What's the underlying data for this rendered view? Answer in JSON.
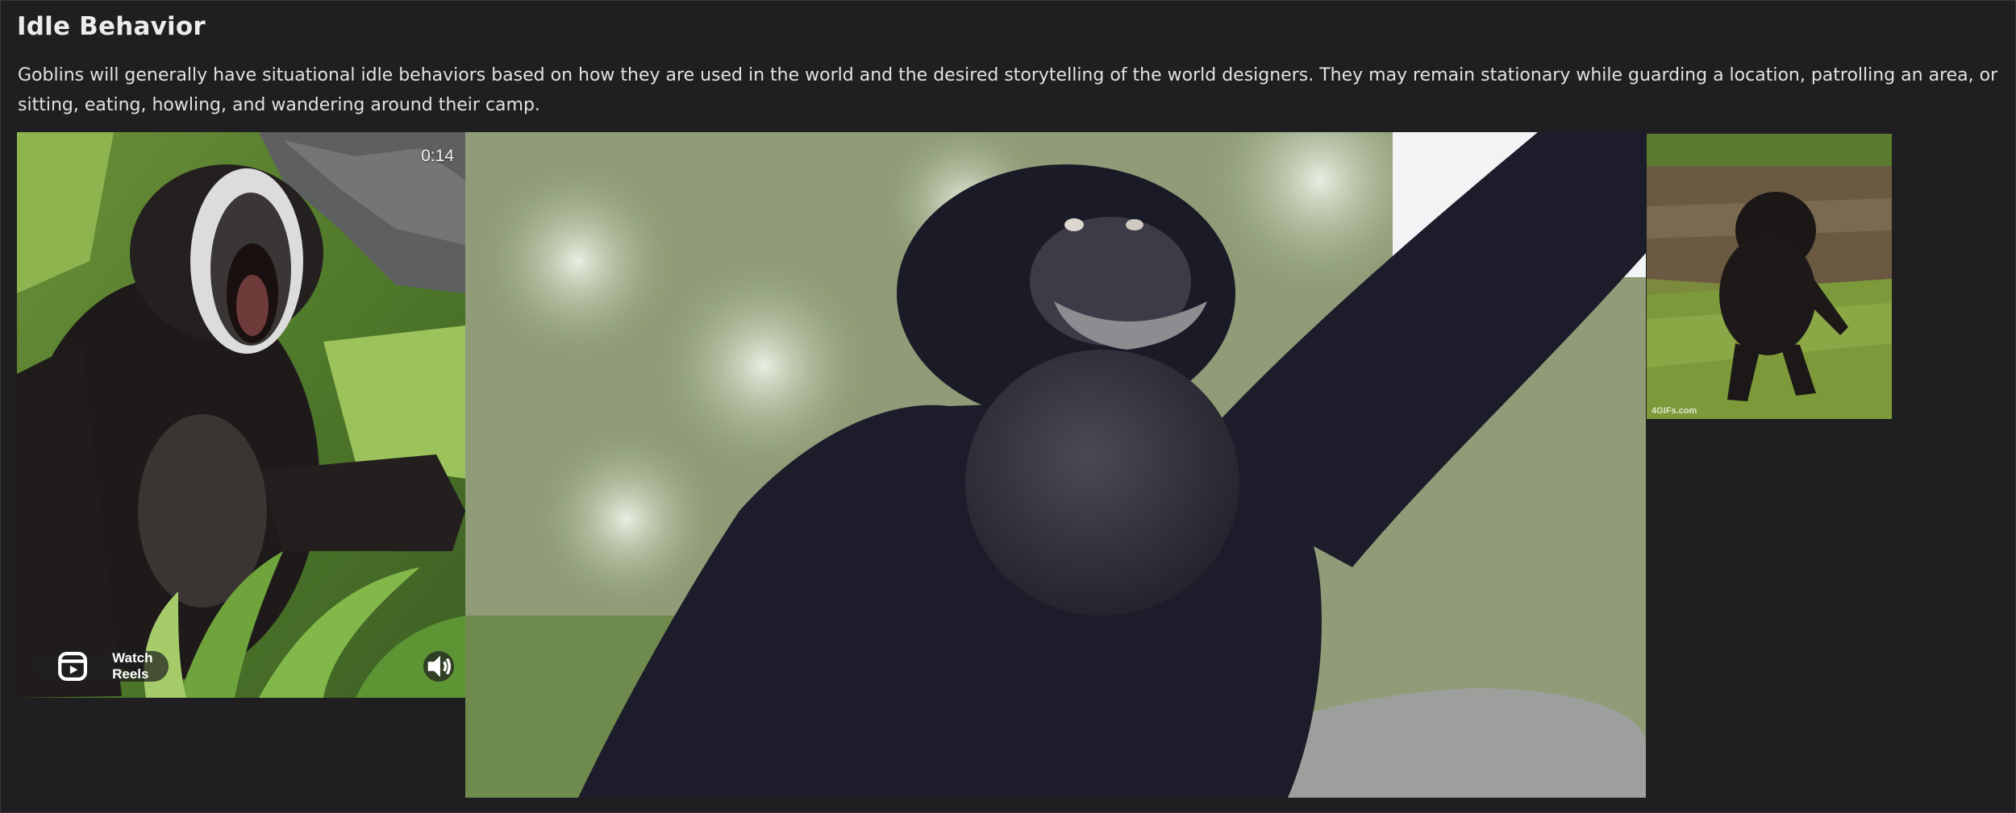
{
  "section": {
    "title": "Idle Behavior",
    "description": "Goblins will generally have situational idle behaviors based on how they are used in the world and the desired storytelling of the world designers.  They may remain stationary while guarding a location, patrolling an area, or sitting, eating, howling, and wandering around their camp."
  },
  "reel": {
    "timer": "0:14",
    "watch_label": "Watch Reels",
    "watch_icon": "reels-icon",
    "sound_icon": "speaker-icon"
  },
  "gif": {
    "watermark": "4GIFs.com"
  },
  "colors": {
    "background": "#1f1f22",
    "text": "#e2e2e2",
    "heading": "#ececec"
  }
}
